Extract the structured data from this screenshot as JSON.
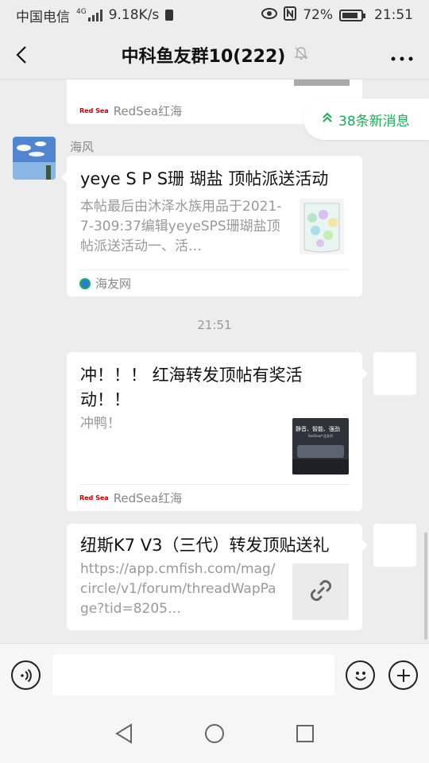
{
  "status_bar": {
    "carrier": "中国电信",
    "network": "4G",
    "speed": "9.18K/s",
    "battery": "72%",
    "time": "21:51",
    "icons": [
      "signal-icon",
      "sim-icon",
      "eye-icon",
      "nfc-icon",
      "battery-icon"
    ]
  },
  "header": {
    "title": "中科鱼友群10(222)",
    "back_icon": "chevron-left-icon",
    "mute_icon": "bell-off-icon",
    "more_icon": "more-dots-icon"
  },
  "new_messages": {
    "label": "38条新消息"
  },
  "messages": {
    "m0": {
      "source": "RedSea红海"
    },
    "m1": {
      "sender": "海风",
      "title": "yeye S P S珊 瑚盐 顶帖派送活动",
      "desc": "本帖最后由沐泽水族用品于2021-7-309:37编辑yeyeSPS珊瑚盐顶帖派送活动一、活…",
      "source": "海友网"
    },
    "time": "21:51",
    "m2": {
      "title": "冲！！！ 红海转发顶帖有奖活动！！",
      "desc": "冲鸭！",
      "thumb_text": "静音、智能、强劲",
      "thumb_sub": "RedSea产品系列",
      "source": "RedSea红海"
    },
    "m3": {
      "title": "纽斯K7 V3（三代）转发顶贴送礼",
      "desc": "https://app.cmfish.com/mag/circle/v1/forum/threadWapPage?tid=8205…"
    }
  },
  "input_bar": {
    "voice_icon": "voice-icon",
    "emoji_icon": "emoji-icon",
    "plus_icon": "plus-icon"
  },
  "nav_bar": {
    "back_icon": "triangle-back-icon",
    "home_icon": "circle-home-icon",
    "recent_icon": "square-recent-icon"
  }
}
